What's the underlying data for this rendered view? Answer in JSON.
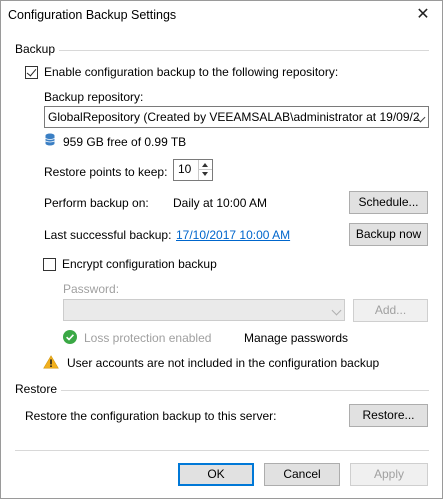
{
  "window": {
    "title": "Configuration Backup Settings",
    "close_glyph": "✕"
  },
  "backup_section": {
    "heading": "Backup",
    "enable_label": "Enable configuration backup to the following repository:",
    "enable_checked": true,
    "repository_label": "Backup repository:",
    "repository_value": "GlobalRepository (Created by VEEAMSALAB\\administrator at 19/09/2",
    "free_space": "959 GB free of 0.99 TB",
    "restore_points_label": "Restore points to keep:",
    "restore_points_value": "10",
    "perform_backup_label": "Perform backup on:",
    "perform_backup_value": "Daily at 10:00 AM",
    "schedule_button": "Schedule...",
    "last_backup_label": "Last successful backup:",
    "last_backup_value": "17/10/2017 10:00 AM",
    "backup_now_button": "Backup now",
    "encrypt_label": "Encrypt configuration backup",
    "encrypt_checked": false,
    "password_label": "Password:",
    "add_button": "Add...",
    "loss_protection_text": "Loss protection enabled",
    "manage_passwords_text": "Manage passwords",
    "warning_text": "User accounts are not included in the configuration backup"
  },
  "restore_section": {
    "heading": "Restore",
    "restore_label": "Restore the configuration backup to this server:",
    "restore_button": "Restore..."
  },
  "footer": {
    "ok": "OK",
    "cancel": "Cancel",
    "apply": "Apply"
  },
  "colors": {
    "link": "#0066cc",
    "success": "#3aa845",
    "warning": "#f2b01e",
    "accent": "#0078d7",
    "db_icon": "#3b7fc4"
  }
}
